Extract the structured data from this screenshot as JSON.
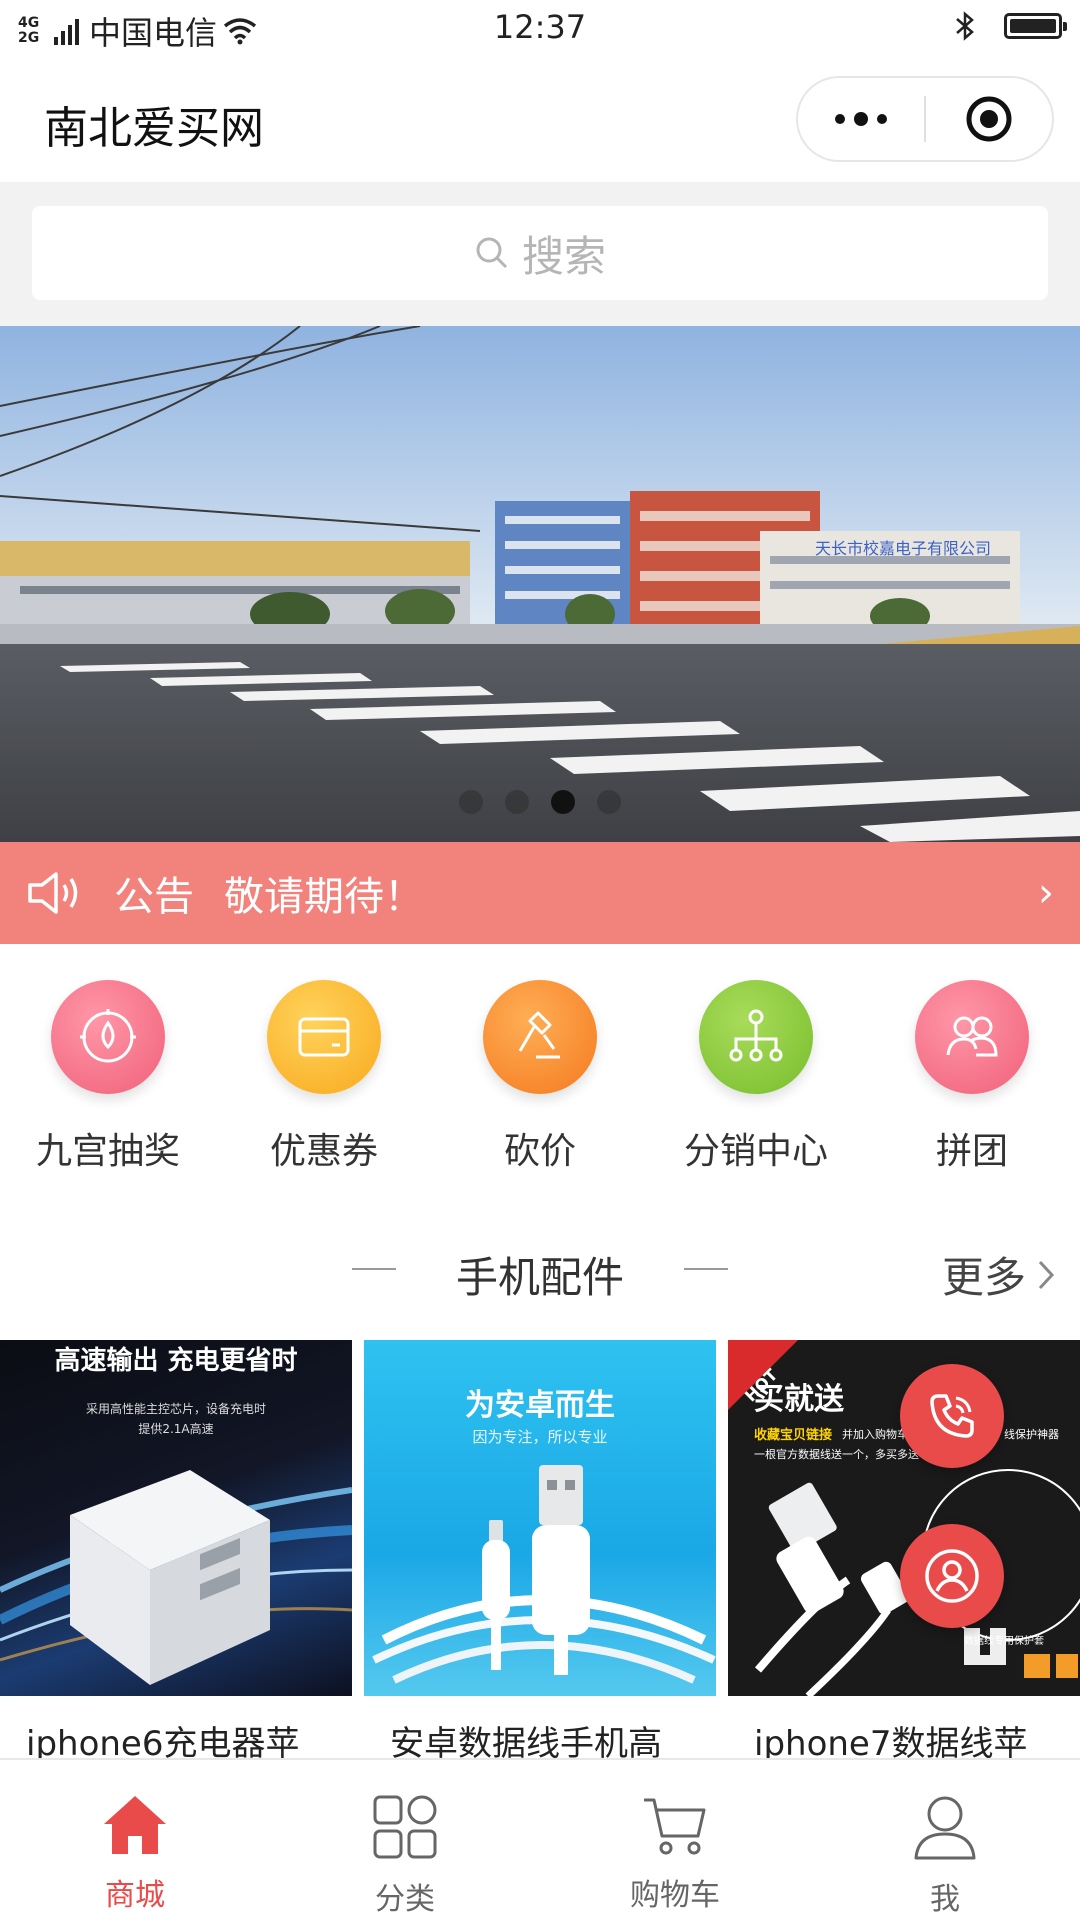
{
  "status_bar": {
    "network": [
      "4G",
      "2G"
    ],
    "carrier": "中国电信",
    "time": "12:37"
  },
  "header": {
    "title": "南北爱买网"
  },
  "search": {
    "placeholder": "搜索"
  },
  "banner": {
    "sign_text": "天长市校嘉电子有限公司",
    "slide_count": 4,
    "active_slide": 3
  },
  "notice": {
    "label": "公告",
    "text": "敬请期待！"
  },
  "features": [
    {
      "label": "九宫抽奖",
      "icon": "lottery-icon",
      "color": "#f56b82"
    },
    {
      "label": "优惠券",
      "icon": "coupon-icon",
      "color": "#fbb529"
    },
    {
      "label": "砍价",
      "icon": "bargain-icon",
      "color": "#f7892b"
    },
    {
      "label": "分销中心",
      "icon": "distribution-icon",
      "color": "#86c93a"
    },
    {
      "label": "拼团",
      "icon": "group-buy-icon",
      "color": "#f56b82"
    }
  ],
  "section": {
    "title": "手机配件",
    "more": "更多"
  },
  "products": [
    {
      "name": "iphone6充电器苹",
      "promo_title": "高速输出 充电更省时",
      "promo_sub1": "采用高性能主控芯片，设备充电时",
      "promo_sub2": "提供2.1A高速"
    },
    {
      "name": "安卓数据线手机高",
      "promo_title": "为安卓而生",
      "promo_sub1": "因为专注，所以专业"
    },
    {
      "name": "iphone7数据线苹",
      "badge": "HOT",
      "promo_title": "买就送",
      "promo_sub1": "收藏宝贝链接",
      "promo_sub2": "并加入购物车",
      "promo_sub3": "一根官方数据线送一个，多买多送",
      "promo_sub4": "线保护神器",
      "promo_sub5": "数据线专用保护套"
    }
  ],
  "tabs": [
    {
      "label": "商城",
      "icon": "home-icon",
      "active": true
    },
    {
      "label": "分类",
      "icon": "category-icon",
      "active": false
    },
    {
      "label": "购物车",
      "icon": "cart-icon",
      "active": false
    },
    {
      "label": "我",
      "icon": "user-icon",
      "active": false
    }
  ],
  "colors": {
    "accent": "#e94a4a",
    "notice_bg": "#f2827c"
  }
}
